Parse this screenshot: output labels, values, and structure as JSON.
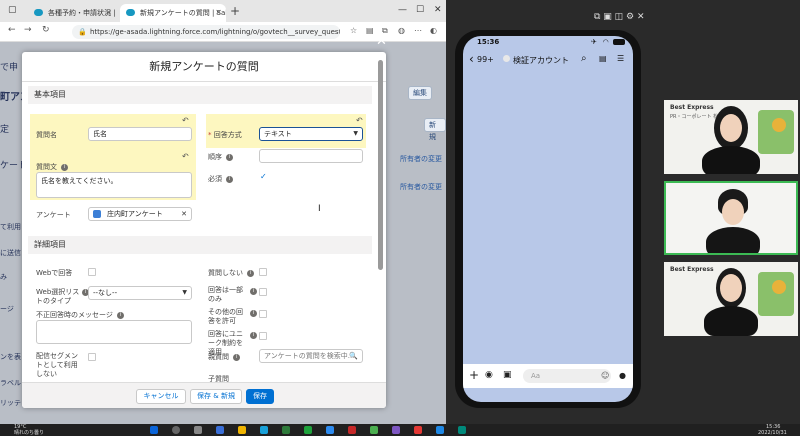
{
  "browser": {
    "tab1_title": "各種予約・申請状況 | Salesforce",
    "tab2_title": "新規アンケートの質問 | Salesforce",
    "url": "https://ge-asada.lightning.force.com/lightning/o/govtech__survey_question__c/new?count...",
    "close_glyph": "✕",
    "newtab_glyph": "+",
    "back_glyph": "←",
    "forward_glyph": "→",
    "reload_glyph": "↻",
    "lock_glyph": "🔒",
    "min_glyph": "—",
    "max_glyph": "☐"
  },
  "sf_bg": {
    "left_frag1": "で申",
    "left_frag2": "町アン",
    "left_frag3": "定",
    "left_frag4": "ケート",
    "left_frag5": "て利用",
    "left_frag6": "に送信",
    "left_frag7": "み",
    "left_frag8": "ージ",
    "left_frag9": "ンを表",
    "left_frag10": "ラベル",
    "left_frag11": "リッテ",
    "btn_edit": "編集",
    "btn_new": "新規",
    "owner_change1": "所有者の変更",
    "owner_change2": "所有者の変更"
  },
  "modal": {
    "title": "新規アンケートの質問",
    "close": "✕",
    "section_basic": "基本項目",
    "section_detail": "詳細項目",
    "question_name_label": "質問名",
    "question_name_value": "氏名",
    "question_text_label": "質問文",
    "question_text_value": "氏名を教えてください。",
    "survey_label": "アンケート",
    "survey_value": "庄内町アンケート",
    "answer_type_label": "回答方式",
    "answer_type_value": "テキスト",
    "order_label": "順序",
    "required_label": "必須",
    "required_checked": "✓",
    "web_answer_label": "Webで回答",
    "web_select_label": "Web選択リストのタイプ",
    "web_select_value": "--なし--",
    "invalid_msg_label": "不正回答時のメッセージ",
    "segment_label": "配信セグメントとして利用しない",
    "no_question_label": "質問しない",
    "single_answer_label": "回答は一部のみ",
    "other_answer_label": "その他の回答を許可",
    "unique_label": "回答にユニーク制約を適用",
    "parent_question_label": "親質問",
    "parent_question_placeholder": "アンケートの質問を検索中...",
    "child_question_label": "子質問",
    "cancel": "キャンセル",
    "save_new": "保存 & 新規",
    "save": "保存",
    "undo_glyph": "↶",
    "info_glyph": "i",
    "caret": "▼",
    "search_glyph": "🔍",
    "remove_glyph": "✕",
    "required_mark": "*"
  },
  "phone": {
    "time": "15:36",
    "back_count": "99+",
    "chat_title": "検証アカウント",
    "compose_placeholder": "Aa",
    "back_glyph": "‹",
    "search_glyph": "⌕",
    "menu_glyph": "☰",
    "note_glyph": "▤",
    "plus_glyph": "+",
    "camera_glyph": "◉",
    "image_glyph": "▣",
    "emoji_glyph": "☺",
    "mic_glyph": "●"
  },
  "meeting": {
    "tile1_logo": "Best Express",
    "tile1_sub": "PR・コーポレート  松尾 明美",
    "tile3_logo": "Best Express",
    "tile3_sub": "",
    "ctrl_icons": "⧉ ▣ ◫ ⚙ ✕"
  },
  "taskbar": {
    "weather": "19°C",
    "weather_sub": "晴れのち曇り",
    "clock_time": "15:36",
    "clock_date": "2022/10/31"
  },
  "colors": {
    "brand": "#0070d2",
    "highlight": "#fdf7c0",
    "phone_chat_bg": "#b8c8e8"
  }
}
